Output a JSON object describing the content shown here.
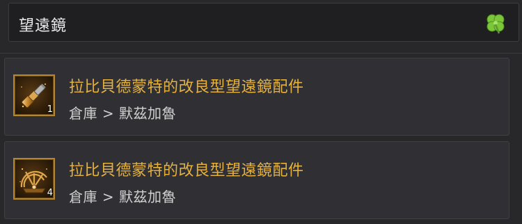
{
  "search": {
    "query": "望遠鏡"
  },
  "results": [
    {
      "name": "拉比貝德蒙特的改良型望遠鏡配件",
      "location": "倉庫 > 默茲加魯",
      "count": "1",
      "icon": "spyglass-icon"
    },
    {
      "name": "拉比貝德蒙特的改良型望遠鏡配件",
      "location": "倉庫 > 默茲加魯",
      "count": "4",
      "icon": "astrolabe-icon"
    }
  ],
  "colors": {
    "item_name": "#e5b13c",
    "location_text": "#d0d0d0",
    "slot_border": "#b3862f",
    "clover": "#7cc63a"
  }
}
